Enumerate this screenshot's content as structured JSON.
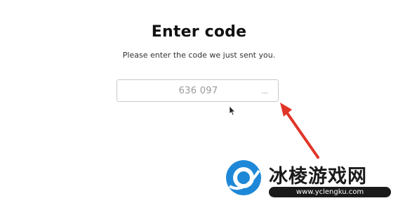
{
  "page": {
    "title": "Enter code",
    "subtitle": "Please enter the code we just sent you."
  },
  "code_input": {
    "value": "636 097",
    "trailing": "..."
  },
  "icons": {
    "cursor": "mouse-pointer-icon",
    "arrow": "red-arrow-annotation"
  },
  "watermark": {
    "name": "冰棱游戏网",
    "url": "www.yclengku.com"
  },
  "colors": {
    "arrow": "#e03526",
    "logo": "#1e88d8",
    "border": "#c9c9c9"
  }
}
